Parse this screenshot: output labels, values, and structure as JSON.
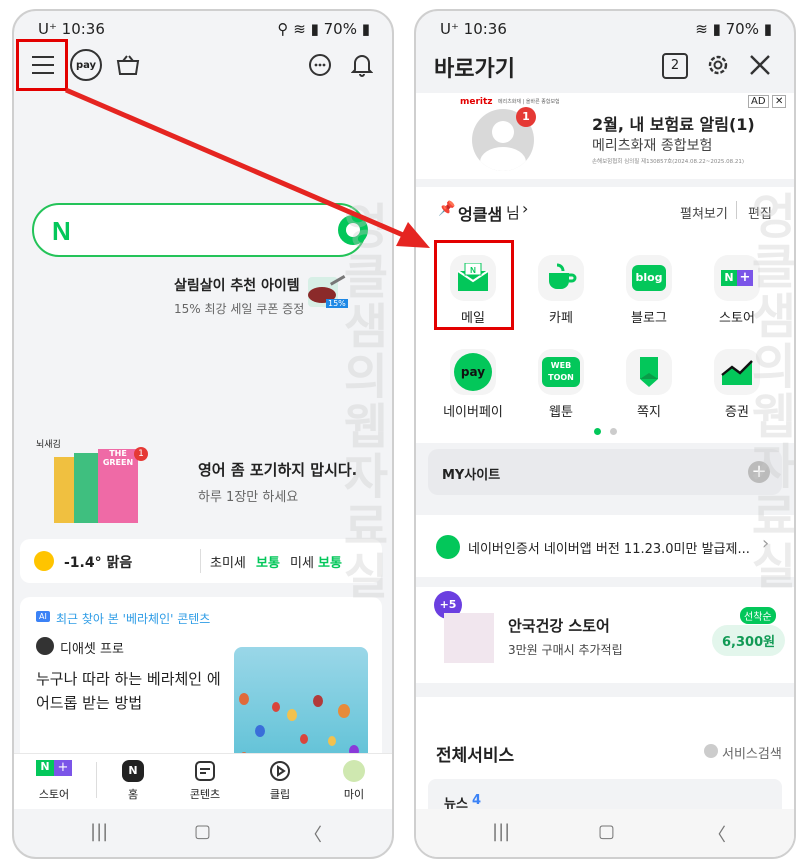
{
  "left": {
    "status": {
      "time": "U⁺ 10:36",
      "battery": "70%"
    },
    "topbar": {
      "pay_label": "pay"
    },
    "search": {
      "logo": "N"
    },
    "promo1": {
      "title": "살림살이 추천 아이템",
      "subtitle": "15% 최강 세일 쿠폰 증정",
      "badge": "15%"
    },
    "promo2": {
      "book_label": "뇌새김",
      "book_spine": "THE GREEN",
      "badge": "1",
      "title": "영어 좀 포기하지 맙시다.",
      "subtitle": "하루 1장만 하세요"
    },
    "weather": {
      "temp": "-1.4° 맑음",
      "fine_label": "초미세",
      "fine_value": "보통",
      "dust_label": "미세",
      "dust_value": "보통"
    },
    "feed": {
      "ai_badge": "AI",
      "tag": "최근 찾아 본 '베라체인' 콘텐츠",
      "author": "디애셋 프로",
      "title": "누구나 따라 하는 베라체인 에어드롭 받는 방법"
    },
    "tabs": [
      {
        "label": "스토어"
      },
      {
        "label": "홈"
      },
      {
        "label": "콘텐츠"
      },
      {
        "label": "클립"
      },
      {
        "label": "마이"
      }
    ],
    "watermark": "엉클샘의웹자료실"
  },
  "right": {
    "status": {
      "time": "U⁺ 10:36",
      "battery": "70%"
    },
    "header": {
      "title": "바로가기",
      "tab_count": "2"
    },
    "ad": {
      "brand": "meritz",
      "brand_sub": "메리츠화재 | 올바른 종합보험",
      "title": "2월, 내 보험료 알림(1)",
      "subtitle": "메리츠화재 종합보험",
      "fine": "손해보험협회 심의필 제130857호(2024.08.22~2025.08.21)",
      "ad_label": "AD",
      "badge": "1"
    },
    "user": {
      "name": "엉클샘",
      "suffix": "님",
      "expand": "펼쳐보기",
      "edit": "편집"
    },
    "apps": [
      {
        "label": "메일",
        "icon": "mail-icon",
        "color": "#03c75a"
      },
      {
        "label": "카페",
        "icon": "cafe-icon",
        "color": "#03c75a"
      },
      {
        "label": "블로그",
        "icon": "blog-icon",
        "color": "#03c75a",
        "text": "blog"
      },
      {
        "label": "스토어",
        "icon": "store-icon",
        "color": "#03c75a"
      },
      {
        "label": "네이버페이",
        "icon": "pay-icon",
        "color": "#03c75a",
        "text": "pay"
      },
      {
        "label": "웹툰",
        "icon": "webtoon-icon",
        "color": "#03c75a",
        "text": "WEB TOON"
      },
      {
        "label": "쪽지",
        "icon": "note-icon",
        "color": "#03c75a"
      },
      {
        "label": "증권",
        "icon": "stock-icon",
        "color": "#03c75a"
      }
    ],
    "mysite": {
      "label": "MY사이트"
    },
    "notice": {
      "text": "네이버인증서 네이버앱 버전 11.23.0미만 발급제..."
    },
    "store_promo": {
      "badge": "+5",
      "title": "안국건강 스토어",
      "subtitle": "3만원 구매시 추가적립",
      "pill_top": "선착순",
      "pill": "6,300원"
    },
    "all_services": {
      "title": "전체서비스",
      "search": "서비스검색",
      "news_label": "뉴스",
      "news_count": "4"
    },
    "watermark": "엉클샘의웹자료실"
  },
  "colors": {
    "naver_green": "#03c75a",
    "highlight_red": "#e30000",
    "arrow_red": "#e52521"
  }
}
